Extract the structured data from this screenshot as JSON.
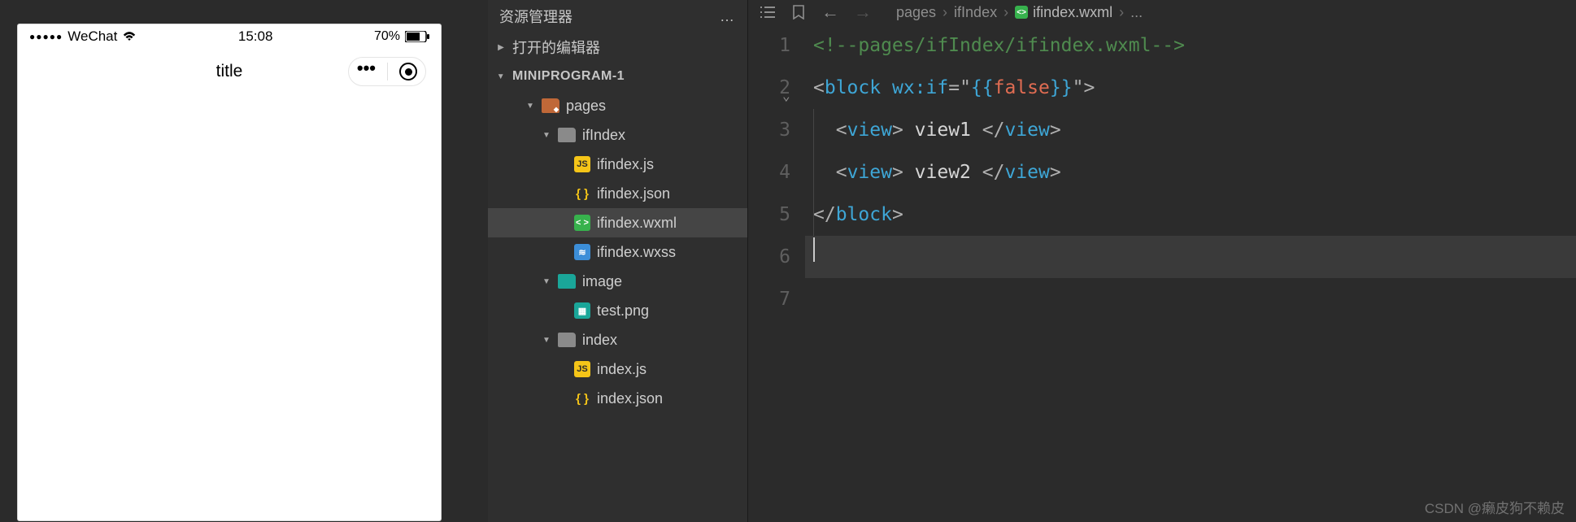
{
  "simulator": {
    "signal_dots": "●●●●●",
    "carrier": "WeChat",
    "time": "15:08",
    "battery_pct": "70%",
    "nav_title": "title",
    "capsule_dots": "•••"
  },
  "explorer": {
    "title": "资源管理器",
    "ellipsis": "…",
    "sections": {
      "open_editors": "打开的编辑器",
      "project": "MINIPROGRAM-1"
    },
    "tree": [
      {
        "name": "pages",
        "type": "folder-red",
        "depth": 2,
        "expanded": true
      },
      {
        "name": "ifIndex",
        "type": "folder-grey",
        "depth": 3,
        "expanded": true
      },
      {
        "name": "ifindex.js",
        "type": "js",
        "depth": 4,
        "icon_text": "JS"
      },
      {
        "name": "ifindex.json",
        "type": "json",
        "depth": 4,
        "icon_text": "{ }"
      },
      {
        "name": "ifindex.wxml",
        "type": "wxml",
        "depth": 4,
        "icon_text": "< >",
        "selected": true
      },
      {
        "name": "ifindex.wxss",
        "type": "wxss",
        "depth": 4,
        "icon_text": "≋"
      },
      {
        "name": "image",
        "type": "folder-img",
        "depth": 3,
        "expanded": true
      },
      {
        "name": "test.png",
        "type": "png",
        "depth": 4,
        "icon_text": "▦"
      },
      {
        "name": "index",
        "type": "folder-grey",
        "depth": 3,
        "expanded": true
      },
      {
        "name": "index.js",
        "type": "js",
        "depth": 4,
        "icon_text": "JS"
      },
      {
        "name": "index.json",
        "type": "json",
        "depth": 4,
        "icon_text": "{ }"
      }
    ]
  },
  "editor": {
    "breadcrumbs": {
      "seg1": "pages",
      "seg2": "ifIndex",
      "file": "ifindex.wxml",
      "tail": "..."
    },
    "line_count": 7,
    "active_line": 6,
    "code": {
      "l1_comment": "<!--pages/ifIndex/ifindex.wxml-->",
      "l2": {
        "open": "<",
        "tag": "block",
        "attr": "wx:if",
        "eq": "=\"",
        "lb": "{{",
        "kw": "false",
        "rb": "}}",
        "qclose": "\"",
        "close": ">"
      },
      "l3": {
        "open": "<",
        "tag": "view",
        "close1": ">",
        "text": " view1 ",
        "open2": "</",
        "close2": ">"
      },
      "l4": {
        "open": "<",
        "tag": "view",
        "close1": ">",
        "text": " view2 ",
        "open2": "</",
        "close2": ">"
      },
      "l5": {
        "open": "</",
        "tag": "block",
        "close": ">"
      }
    }
  },
  "watermark": "CSDN @癞皮狗不赖皮"
}
